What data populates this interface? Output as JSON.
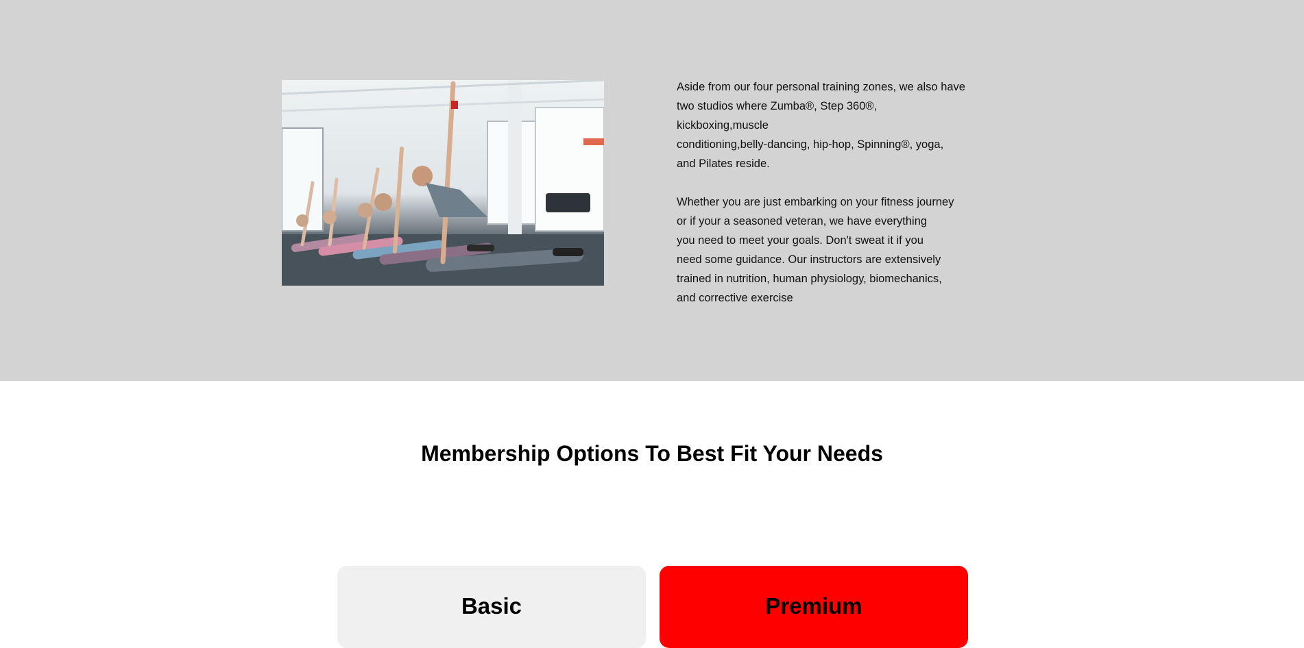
{
  "about": {
    "image_alt": "Group fitness class doing side planks in a gym studio",
    "paragraph1": "Aside from our four personal training zones, we also have\ntwo studios where Zumba®, Step 360®, kickboxing,muscle\nconditioning,belly-dancing, hip-hop, Spinning®, yoga,\nand Pilates reside.",
    "paragraph2": "Whether you are just embarking on your fitness journey\nor if your a seasoned veteran, we have everything\nyou need to meet your goals. Don't sweat it if you\nneed some guidance. Our instructors are extensively\ntrained in nutrition, human physiology, biomechanics,\nand corrective exercise"
  },
  "membership": {
    "title": "Membership Options To Best Fit Your Needs",
    "plans": [
      {
        "name": "Basic",
        "background": "#f0f0f0"
      },
      {
        "name": "Premium",
        "background": "#ff0000"
      }
    ]
  },
  "colors": {
    "section_background": "#d3d3d3",
    "accent": "#ff0000"
  }
}
